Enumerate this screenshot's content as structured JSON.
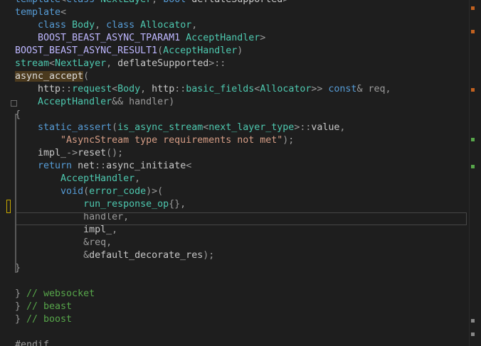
{
  "lines": [
    {
      "parts": [
        [
          "k",
          "template"
        ],
        [
          "p",
          "<"
        ],
        [
          "k",
          "class "
        ],
        [
          "t",
          "NextLayer"
        ],
        [
          "p",
          ", "
        ],
        [
          "k",
          "bool "
        ],
        [
          "n",
          "deflateSupported"
        ],
        [
          "p",
          ">"
        ]
      ]
    },
    {
      "parts": [
        [
          "k",
          "template"
        ],
        [
          "p",
          "<"
        ]
      ]
    },
    {
      "parts": [
        [
          "n",
          "    "
        ],
        [
          "k",
          "class "
        ],
        [
          "t",
          "Body"
        ],
        [
          "p",
          ", "
        ],
        [
          "k",
          "class "
        ],
        [
          "t",
          "Allocator"
        ],
        [
          "p",
          ","
        ]
      ]
    },
    {
      "parts": [
        [
          "n",
          "    "
        ],
        [
          "m",
          "BOOST_BEAST_ASYNC_TPARAM1 "
        ],
        [
          "t",
          "AcceptHandler"
        ],
        [
          "p",
          ">"
        ]
      ]
    },
    {
      "parts": [
        [
          "m",
          "BOOST_BEAST_ASYNC_RESULT1"
        ],
        [
          "p",
          "("
        ],
        [
          "t",
          "AcceptHandler"
        ],
        [
          "p",
          ")"
        ]
      ]
    },
    {
      "parts": [
        [
          "t",
          "stream"
        ],
        [
          "p",
          "<"
        ],
        [
          "t",
          "NextLayer"
        ],
        [
          "p",
          ", "
        ],
        [
          "n",
          "deflateSupported"
        ],
        [
          "p",
          ">::"
        ]
      ]
    },
    {
      "parts": [
        [
          "hl",
          "async_accept"
        ],
        [
          "p",
          "("
        ]
      ]
    },
    {
      "parts": [
        [
          "n",
          "    http"
        ],
        [
          "p",
          "::"
        ],
        [
          "t",
          "request"
        ],
        [
          "p",
          "<"
        ],
        [
          "t",
          "Body"
        ],
        [
          "p",
          ", "
        ],
        [
          "n",
          "http"
        ],
        [
          "p",
          "::"
        ],
        [
          "t",
          "basic_fields"
        ],
        [
          "p",
          "<"
        ],
        [
          "t",
          "Allocator"
        ],
        [
          "p",
          ">> "
        ],
        [
          "k",
          "const"
        ],
        [
          "p",
          "& "
        ],
        [
          "pr",
          "req"
        ],
        [
          "p",
          ","
        ]
      ]
    },
    {
      "parts": [
        [
          "n",
          "    "
        ],
        [
          "t",
          "AcceptHandler"
        ],
        [
          "p",
          "&& "
        ],
        [
          "pr",
          "handler"
        ],
        [
          "p",
          ")"
        ]
      ]
    },
    {
      "parts": [
        [
          "p",
          "{"
        ]
      ]
    },
    {
      "parts": [
        [
          "n",
          "    "
        ],
        [
          "k",
          "static_assert"
        ],
        [
          "p",
          "("
        ],
        [
          "t",
          "is_async_stream"
        ],
        [
          "p",
          "<"
        ],
        [
          "t",
          "next_layer_type"
        ],
        [
          "p",
          ">::"
        ],
        [
          "n",
          "value"
        ],
        [
          "p",
          ","
        ]
      ]
    },
    {
      "parts": [
        [
          "n",
          "        "
        ],
        [
          "s",
          "\"AsyncStream type requirements not met\""
        ],
        [
          "p",
          ");"
        ]
      ]
    },
    {
      "parts": [
        [
          "n",
          "    impl_"
        ],
        [
          "p",
          "->"
        ],
        [
          "n",
          "reset"
        ],
        [
          "p",
          "();"
        ]
      ]
    },
    {
      "parts": [
        [
          "n",
          "    "
        ],
        [
          "k",
          "return "
        ],
        [
          "n",
          "net"
        ],
        [
          "p",
          "::"
        ],
        [
          "n",
          "async_initiate"
        ],
        [
          "p",
          "<"
        ]
      ]
    },
    {
      "parts": [
        [
          "n",
          "        "
        ],
        [
          "t",
          "AcceptHandler"
        ],
        [
          "p",
          ","
        ]
      ]
    },
    {
      "parts": [
        [
          "n",
          "        "
        ],
        [
          "k",
          "void"
        ],
        [
          "p",
          "("
        ],
        [
          "t",
          "error_code"
        ],
        [
          "p",
          ")>("
        ]
      ]
    },
    {
      "parts": [
        [
          "n",
          "            "
        ],
        [
          "t",
          "run_response_op"
        ],
        [
          "p",
          "{},"
        ]
      ]
    },
    {
      "parts": [
        [
          "n",
          "            "
        ],
        [
          "pr",
          "handler"
        ],
        [
          "p",
          ","
        ]
      ]
    },
    {
      "parts": [
        [
          "n",
          "            impl_"
        ],
        [
          "p",
          ","
        ]
      ]
    },
    {
      "parts": [
        [
          "n",
          "            "
        ],
        [
          "p",
          "&"
        ],
        [
          "pr",
          "req"
        ],
        [
          "p",
          ","
        ]
      ]
    },
    {
      "parts": [
        [
          "n",
          "            "
        ],
        [
          "p",
          "&"
        ],
        [
          "n",
          "default_decorate_res"
        ],
        [
          "p",
          ");"
        ]
      ]
    },
    {
      "parts": [
        [
          "p",
          "}"
        ]
      ]
    },
    {
      "parts": [
        [
          "n",
          ""
        ]
      ]
    },
    {
      "parts": [
        [
          "p",
          "} "
        ],
        [
          "c",
          "// websocket"
        ]
      ]
    },
    {
      "parts": [
        [
          "p",
          "} "
        ],
        [
          "c",
          "// beast"
        ]
      ]
    },
    {
      "parts": [
        [
          "p",
          "} "
        ],
        [
          "c",
          "// boost"
        ]
      ]
    },
    {
      "parts": [
        [
          "n",
          ""
        ]
      ]
    },
    {
      "parts": [
        [
          "pp",
          "#endif"
        ]
      ]
    }
  ],
  "colors": {
    "background": "#1e1e1e",
    "keyword": "#569cd6",
    "type": "#4ec9b0",
    "string": "#d69d85",
    "comment": "#57a64a"
  }
}
